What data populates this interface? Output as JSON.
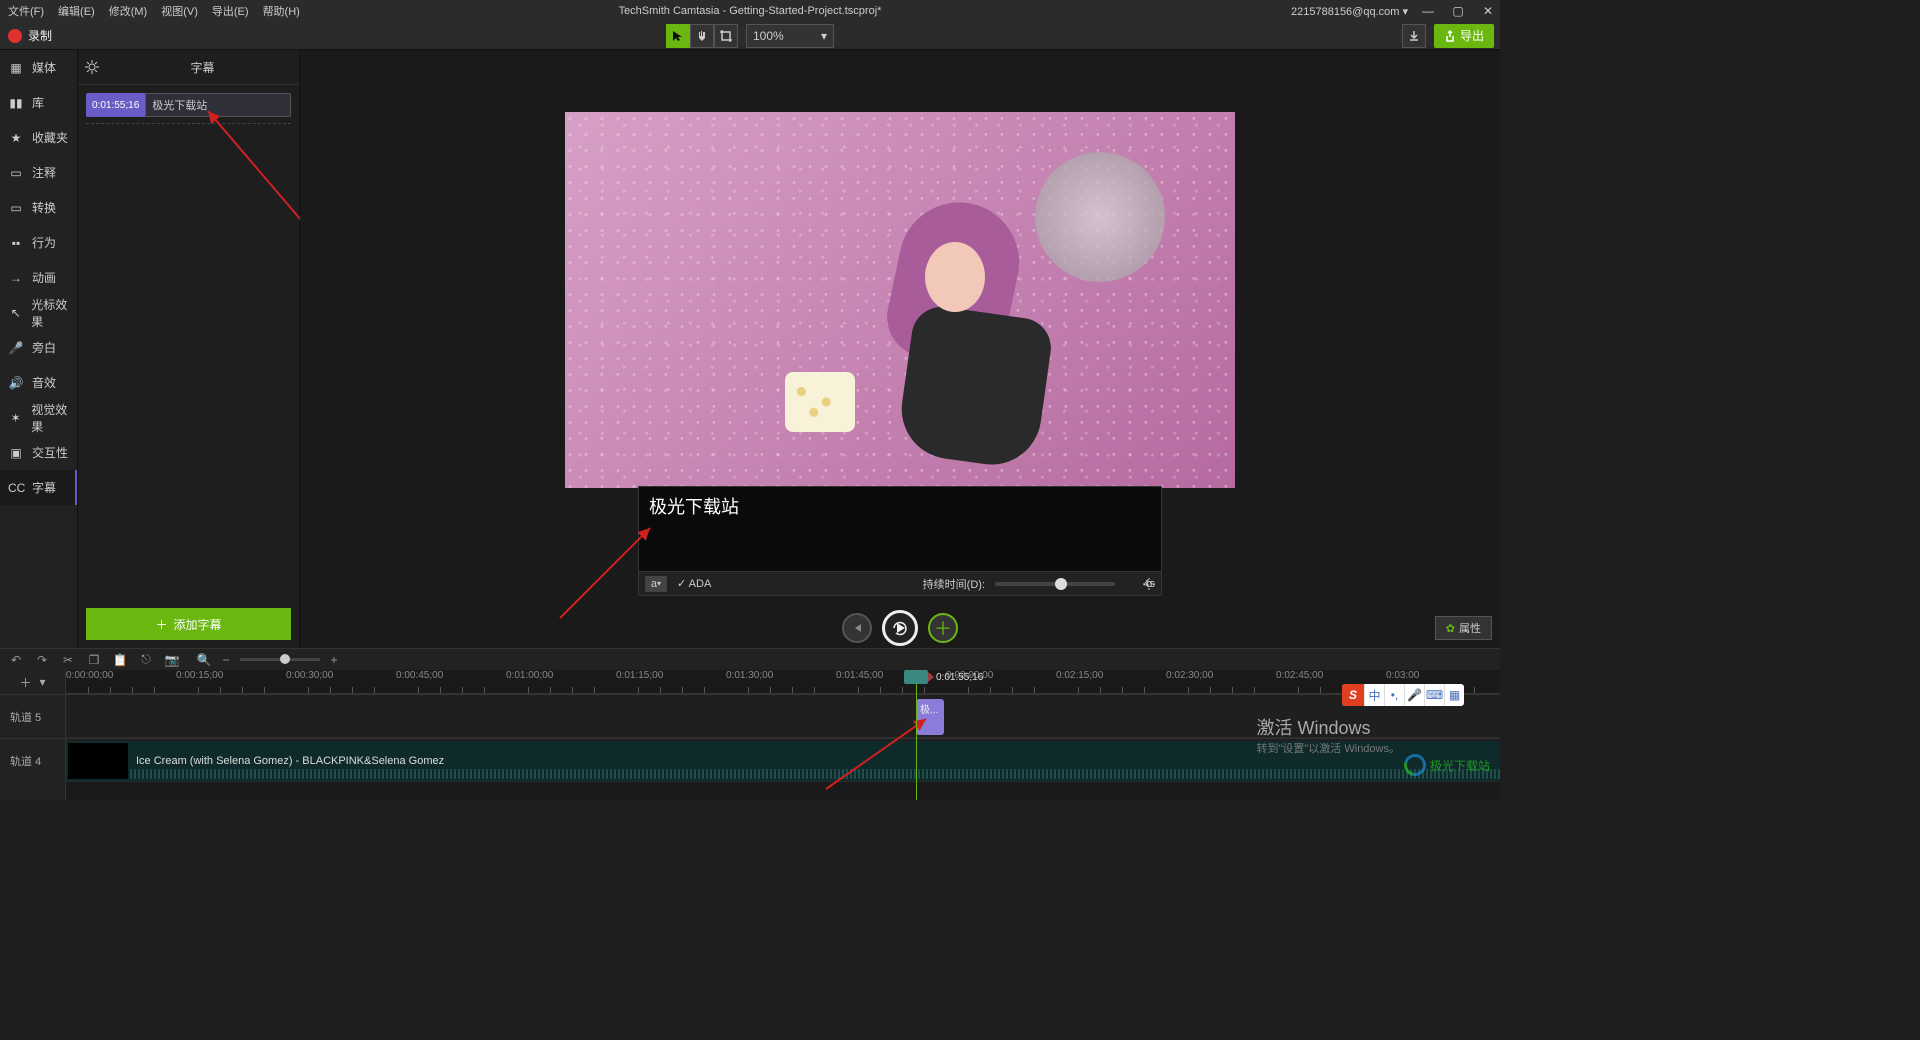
{
  "menubar": {
    "items": [
      "文件(F)",
      "编辑(E)",
      "修改(M)",
      "视图(V)",
      "导出(E)",
      "帮助(H)"
    ],
    "title": "TechSmith Camtasia - Getting-Started-Project.tscproj*",
    "account": "2215788156@qq.com ▾"
  },
  "recordbar": {
    "record_label": "录制",
    "zoom": "100%",
    "export_label": "导出"
  },
  "side_tools": [
    {
      "icon": "film",
      "label": "媒体"
    },
    {
      "icon": "books",
      "label": "库"
    },
    {
      "icon": "star",
      "label": "收藏夹"
    },
    {
      "icon": "callout",
      "label": "注释"
    },
    {
      "icon": "transition",
      "label": "转换"
    },
    {
      "icon": "behavior",
      "label": "行为"
    },
    {
      "icon": "motion",
      "label": "动画"
    },
    {
      "icon": "cursor",
      "label": "光标效果"
    },
    {
      "icon": "mic",
      "label": "旁白"
    },
    {
      "icon": "speaker",
      "label": "音效"
    },
    {
      "icon": "fx",
      "label": "视觉效果"
    },
    {
      "icon": "interact",
      "label": "交互性"
    },
    {
      "icon": "cc",
      "label": "字幕"
    }
  ],
  "caption_panel": {
    "title": "字幕",
    "items": [
      {
        "time": "0:01:55;16",
        "text": "极光下载站"
      }
    ],
    "add_label": "添加字幕"
  },
  "caption_editor": {
    "text": "极光下载站",
    "ada_label": "ADA",
    "duration_label": "持续时间(D):",
    "duration_value": "4s"
  },
  "properties_label": "属性",
  "timeline": {
    "playhead_time": "0:01:55;16",
    "ticks": [
      "0:00:00;00",
      "0:00:15;00",
      "0:00:30;00",
      "0:00:45;00",
      "0:01:00;00",
      "0:01:15;00",
      "0:01:30;00",
      "0:01:45;00",
      "0:02:00;00",
      "0:02:15;00",
      "0:02:30;00",
      "0:02:45;00",
      "0:03:00"
    ],
    "tracks": [
      {
        "name": "轨道 5"
      },
      {
        "name": "轨道 4"
      }
    ],
    "caption_clip_label": "极...",
    "video_clip_label": "Ice Cream (with Selena Gomez) - BLACKPINK&Selena Gomez"
  },
  "activate": {
    "line1": "激活 Windows",
    "line2": "转到\"设置\"以激活 Windows。"
  },
  "logo_text": "极光下载站",
  "ime": {
    "lang": "中"
  }
}
